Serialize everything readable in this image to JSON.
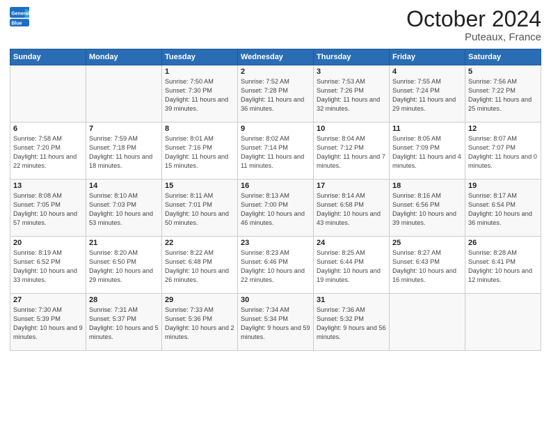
{
  "logo": {
    "line1": "General",
    "line2": "Blue"
  },
  "title": "October 2024",
  "subtitle": "Puteaux, France",
  "weekdays": [
    "Sunday",
    "Monday",
    "Tuesday",
    "Wednesday",
    "Thursday",
    "Friday",
    "Saturday"
  ],
  "weeks": [
    [
      {
        "day": "",
        "content": ""
      },
      {
        "day": "",
        "content": ""
      },
      {
        "day": "1",
        "content": "Sunrise: 7:50 AM\nSunset: 7:30 PM\nDaylight: 11 hours and 39 minutes."
      },
      {
        "day": "2",
        "content": "Sunrise: 7:52 AM\nSunset: 7:28 PM\nDaylight: 11 hours and 36 minutes."
      },
      {
        "day": "3",
        "content": "Sunrise: 7:53 AM\nSunset: 7:26 PM\nDaylight: 11 hours and 32 minutes."
      },
      {
        "day": "4",
        "content": "Sunrise: 7:55 AM\nSunset: 7:24 PM\nDaylight: 11 hours and 29 minutes."
      },
      {
        "day": "5",
        "content": "Sunrise: 7:56 AM\nSunset: 7:22 PM\nDaylight: 11 hours and 25 minutes."
      }
    ],
    [
      {
        "day": "6",
        "content": "Sunrise: 7:58 AM\nSunset: 7:20 PM\nDaylight: 11 hours and 22 minutes."
      },
      {
        "day": "7",
        "content": "Sunrise: 7:59 AM\nSunset: 7:18 PM\nDaylight: 11 hours and 18 minutes."
      },
      {
        "day": "8",
        "content": "Sunrise: 8:01 AM\nSunset: 7:16 PM\nDaylight: 11 hours and 15 minutes."
      },
      {
        "day": "9",
        "content": "Sunrise: 8:02 AM\nSunset: 7:14 PM\nDaylight: 11 hours and 11 minutes."
      },
      {
        "day": "10",
        "content": "Sunrise: 8:04 AM\nSunset: 7:12 PM\nDaylight: 11 hours and 7 minutes."
      },
      {
        "day": "11",
        "content": "Sunrise: 8:05 AM\nSunset: 7:09 PM\nDaylight: 11 hours and 4 minutes."
      },
      {
        "day": "12",
        "content": "Sunrise: 8:07 AM\nSunset: 7:07 PM\nDaylight: 11 hours and 0 minutes."
      }
    ],
    [
      {
        "day": "13",
        "content": "Sunrise: 8:08 AM\nSunset: 7:05 PM\nDaylight: 10 hours and 57 minutes."
      },
      {
        "day": "14",
        "content": "Sunrise: 8:10 AM\nSunset: 7:03 PM\nDaylight: 10 hours and 53 minutes."
      },
      {
        "day": "15",
        "content": "Sunrise: 8:11 AM\nSunset: 7:01 PM\nDaylight: 10 hours and 50 minutes."
      },
      {
        "day": "16",
        "content": "Sunrise: 8:13 AM\nSunset: 7:00 PM\nDaylight: 10 hours and 46 minutes."
      },
      {
        "day": "17",
        "content": "Sunrise: 8:14 AM\nSunset: 6:58 PM\nDaylight: 10 hours and 43 minutes."
      },
      {
        "day": "18",
        "content": "Sunrise: 8:16 AM\nSunset: 6:56 PM\nDaylight: 10 hours and 39 minutes."
      },
      {
        "day": "19",
        "content": "Sunrise: 8:17 AM\nSunset: 6:54 PM\nDaylight: 10 hours and 36 minutes."
      }
    ],
    [
      {
        "day": "20",
        "content": "Sunrise: 8:19 AM\nSunset: 6:52 PM\nDaylight: 10 hours and 33 minutes."
      },
      {
        "day": "21",
        "content": "Sunrise: 8:20 AM\nSunset: 6:50 PM\nDaylight: 10 hours and 29 minutes."
      },
      {
        "day": "22",
        "content": "Sunrise: 8:22 AM\nSunset: 6:48 PM\nDaylight: 10 hours and 26 minutes."
      },
      {
        "day": "23",
        "content": "Sunrise: 8:23 AM\nSunset: 6:46 PM\nDaylight: 10 hours and 22 minutes."
      },
      {
        "day": "24",
        "content": "Sunrise: 8:25 AM\nSunset: 6:44 PM\nDaylight: 10 hours and 19 minutes."
      },
      {
        "day": "25",
        "content": "Sunrise: 8:27 AM\nSunset: 6:43 PM\nDaylight: 10 hours and 16 minutes."
      },
      {
        "day": "26",
        "content": "Sunrise: 8:28 AM\nSunset: 6:41 PM\nDaylight: 10 hours and 12 minutes."
      }
    ],
    [
      {
        "day": "27",
        "content": "Sunrise: 7:30 AM\nSunset: 5:39 PM\nDaylight: 10 hours and 9 minutes."
      },
      {
        "day": "28",
        "content": "Sunrise: 7:31 AM\nSunset: 5:37 PM\nDaylight: 10 hours and 5 minutes."
      },
      {
        "day": "29",
        "content": "Sunrise: 7:33 AM\nSunset: 5:36 PM\nDaylight: 10 hours and 2 minutes."
      },
      {
        "day": "30",
        "content": "Sunrise: 7:34 AM\nSunset: 5:34 PM\nDaylight: 9 hours and 59 minutes."
      },
      {
        "day": "31",
        "content": "Sunrise: 7:36 AM\nSunset: 5:32 PM\nDaylight: 9 hours and 56 minutes."
      },
      {
        "day": "",
        "content": ""
      },
      {
        "day": "",
        "content": ""
      }
    ]
  ]
}
